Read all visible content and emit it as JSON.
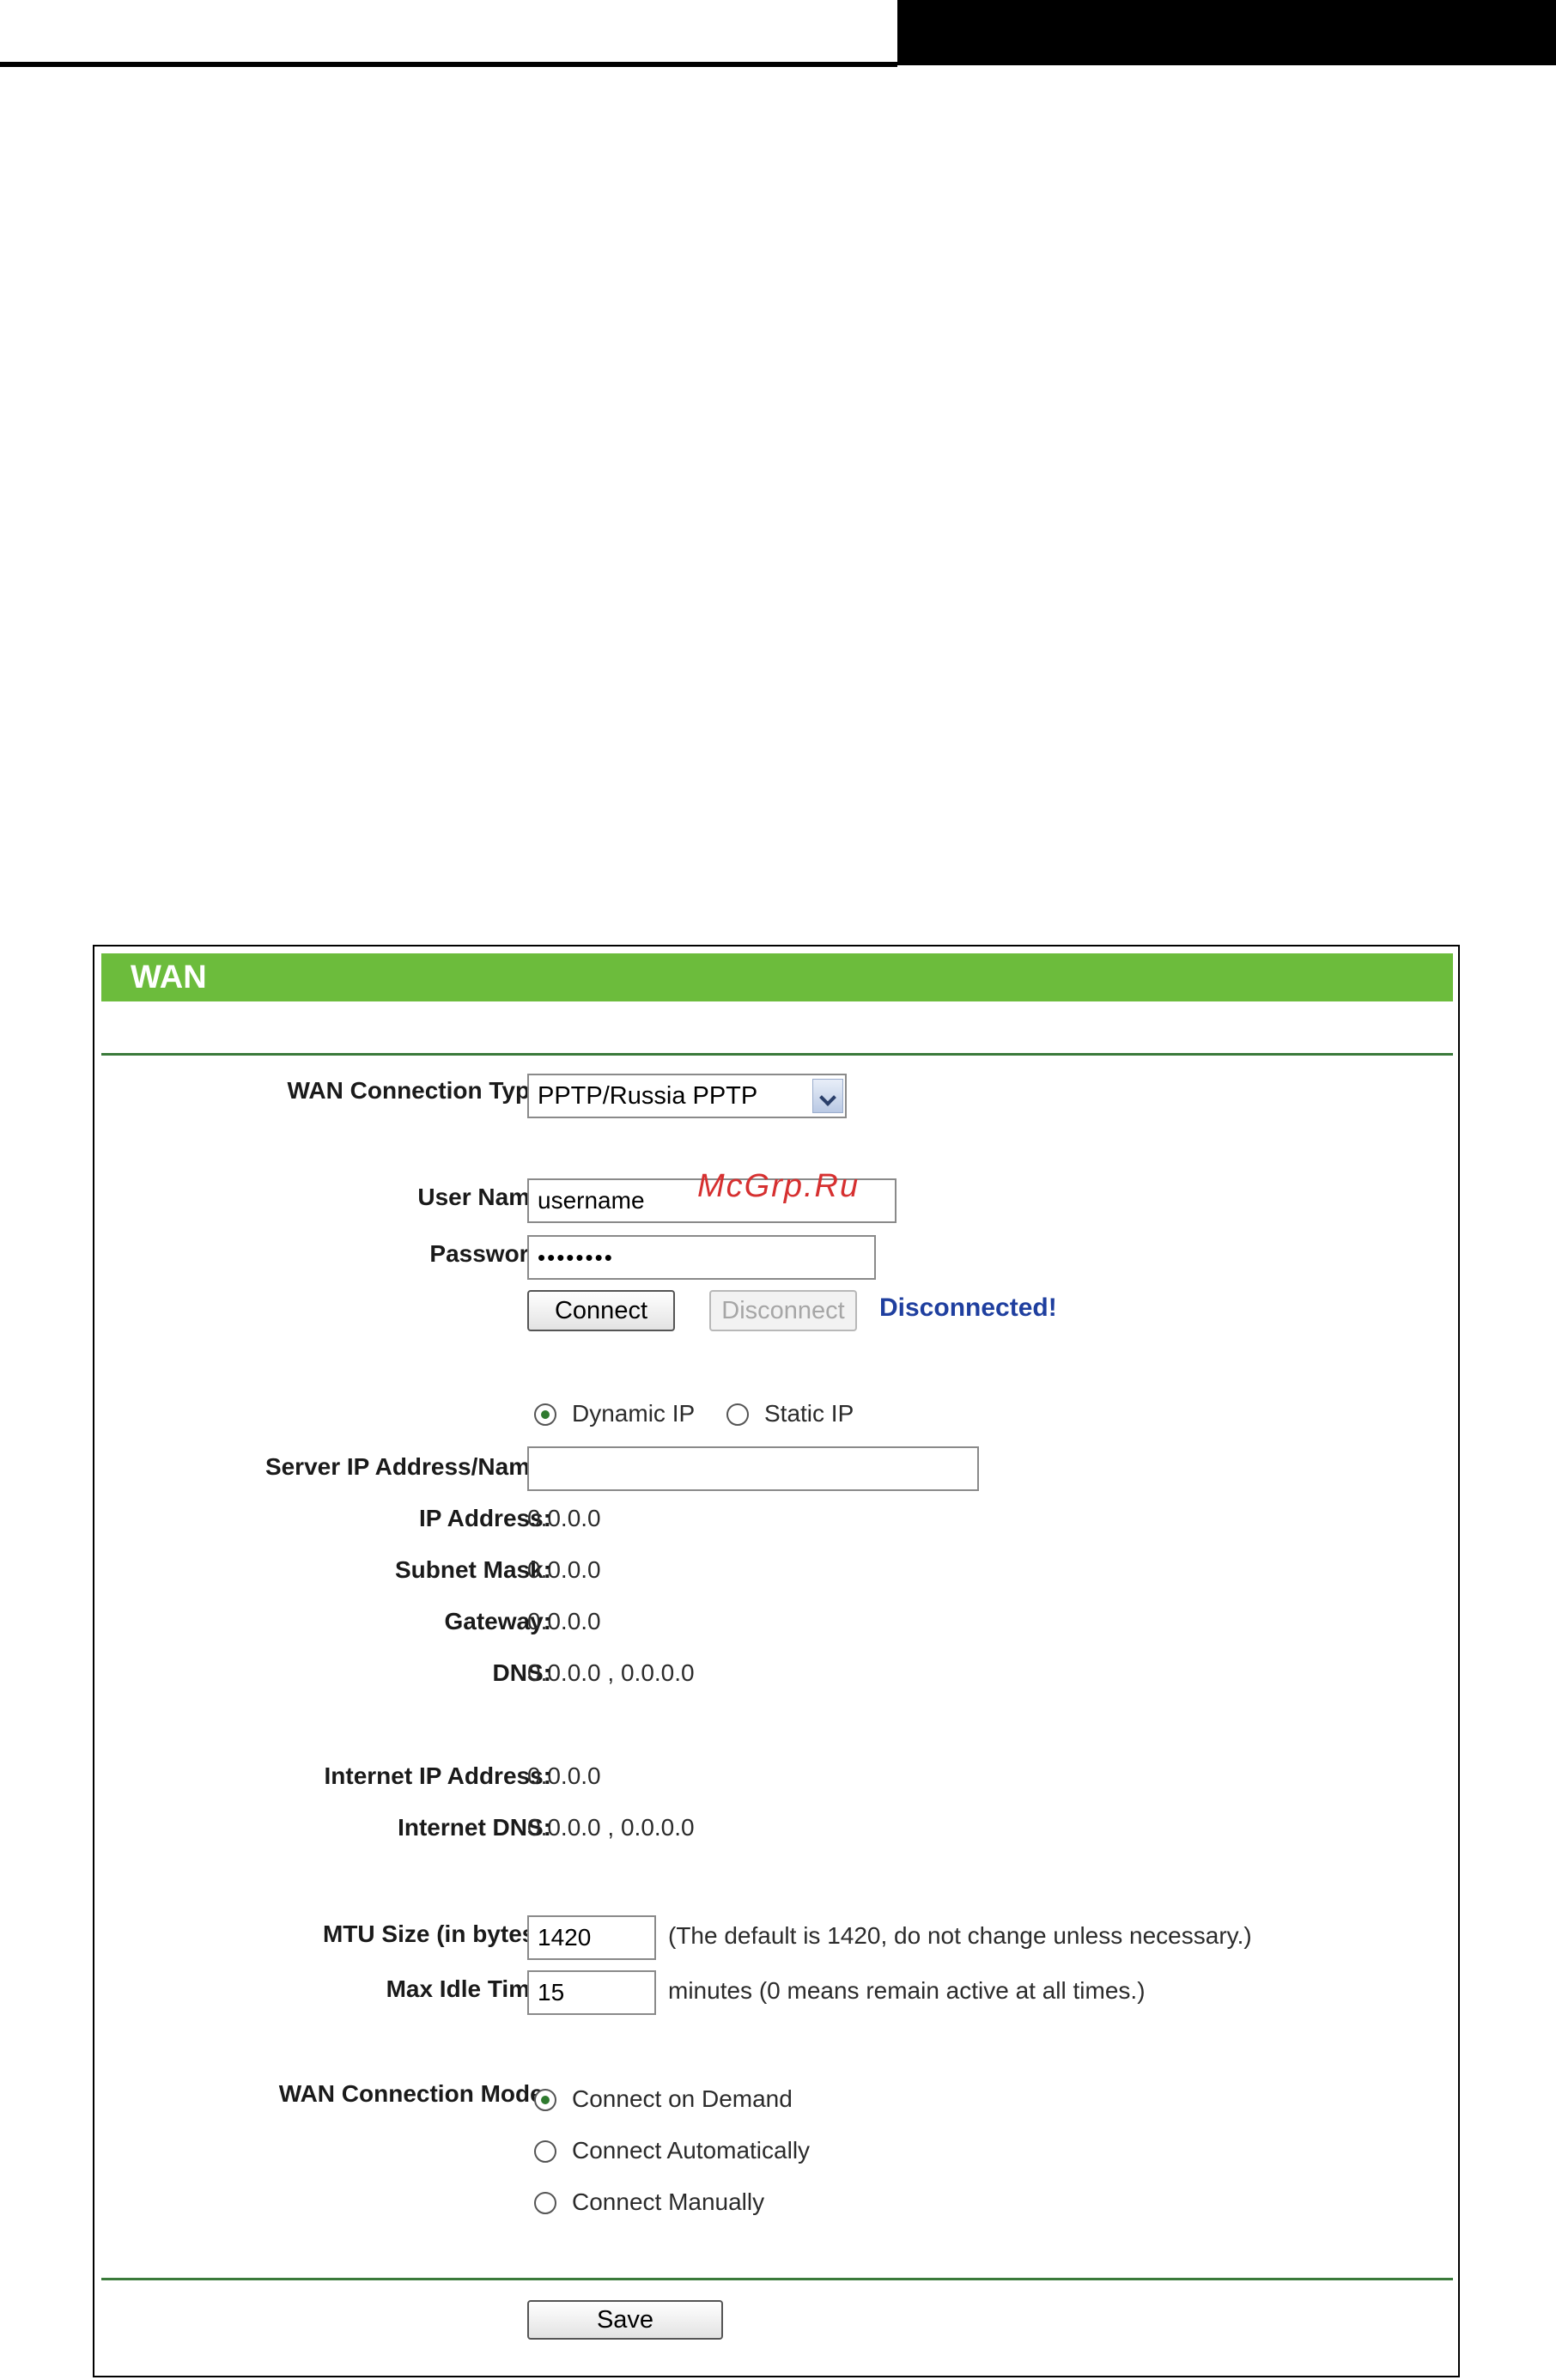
{
  "watermark": "McGrp.Ru",
  "panel": {
    "title": "WAN"
  },
  "form": {
    "connection_type_label": "WAN Connection Type:",
    "connection_type_value": "PPTP/Russia PPTP",
    "user_name_label": "User Name:",
    "user_name_value": "username",
    "password_label": "Password:",
    "password_value": "••••••••",
    "connect_label": "Connect",
    "disconnect_label": "Disconnect",
    "status_text": "Disconnected!",
    "ip_mode_dynamic": "Dynamic IP",
    "ip_mode_static": "Static IP",
    "ip_mode_selected": "Dynamic IP",
    "server_label": "Server IP Address/Name:",
    "server_value": "",
    "ip_label": "IP Address:",
    "ip_value": "0.0.0.0",
    "mask_label": "Subnet Mask:",
    "mask_value": "0.0.0.0",
    "gateway_label": "Gateway:",
    "gateway_value": "0.0.0.0",
    "dns_label": "DNS:",
    "dns_value": "0.0.0.0 , 0.0.0.0",
    "inet_ip_label": "Internet IP Address:",
    "inet_ip_value": "0.0.0.0",
    "inet_dns_label": "Internet DNS:",
    "inet_dns_value": "0.0.0.0 , 0.0.0.0",
    "mtu_label": "MTU Size (in bytes):",
    "mtu_value": "1420",
    "mtu_hint": "(The default is 1420, do not change unless necessary.)",
    "idle_label": "Max Idle Time:",
    "idle_value": "15",
    "idle_hint": "minutes (0 means remain active at all times.)",
    "mode_label": "WAN Connection Mode:",
    "mode_options": [
      "Connect on Demand",
      "Connect Automatically",
      "Connect Manually"
    ],
    "mode_selected": "Connect on Demand",
    "save_label": "Save"
  }
}
